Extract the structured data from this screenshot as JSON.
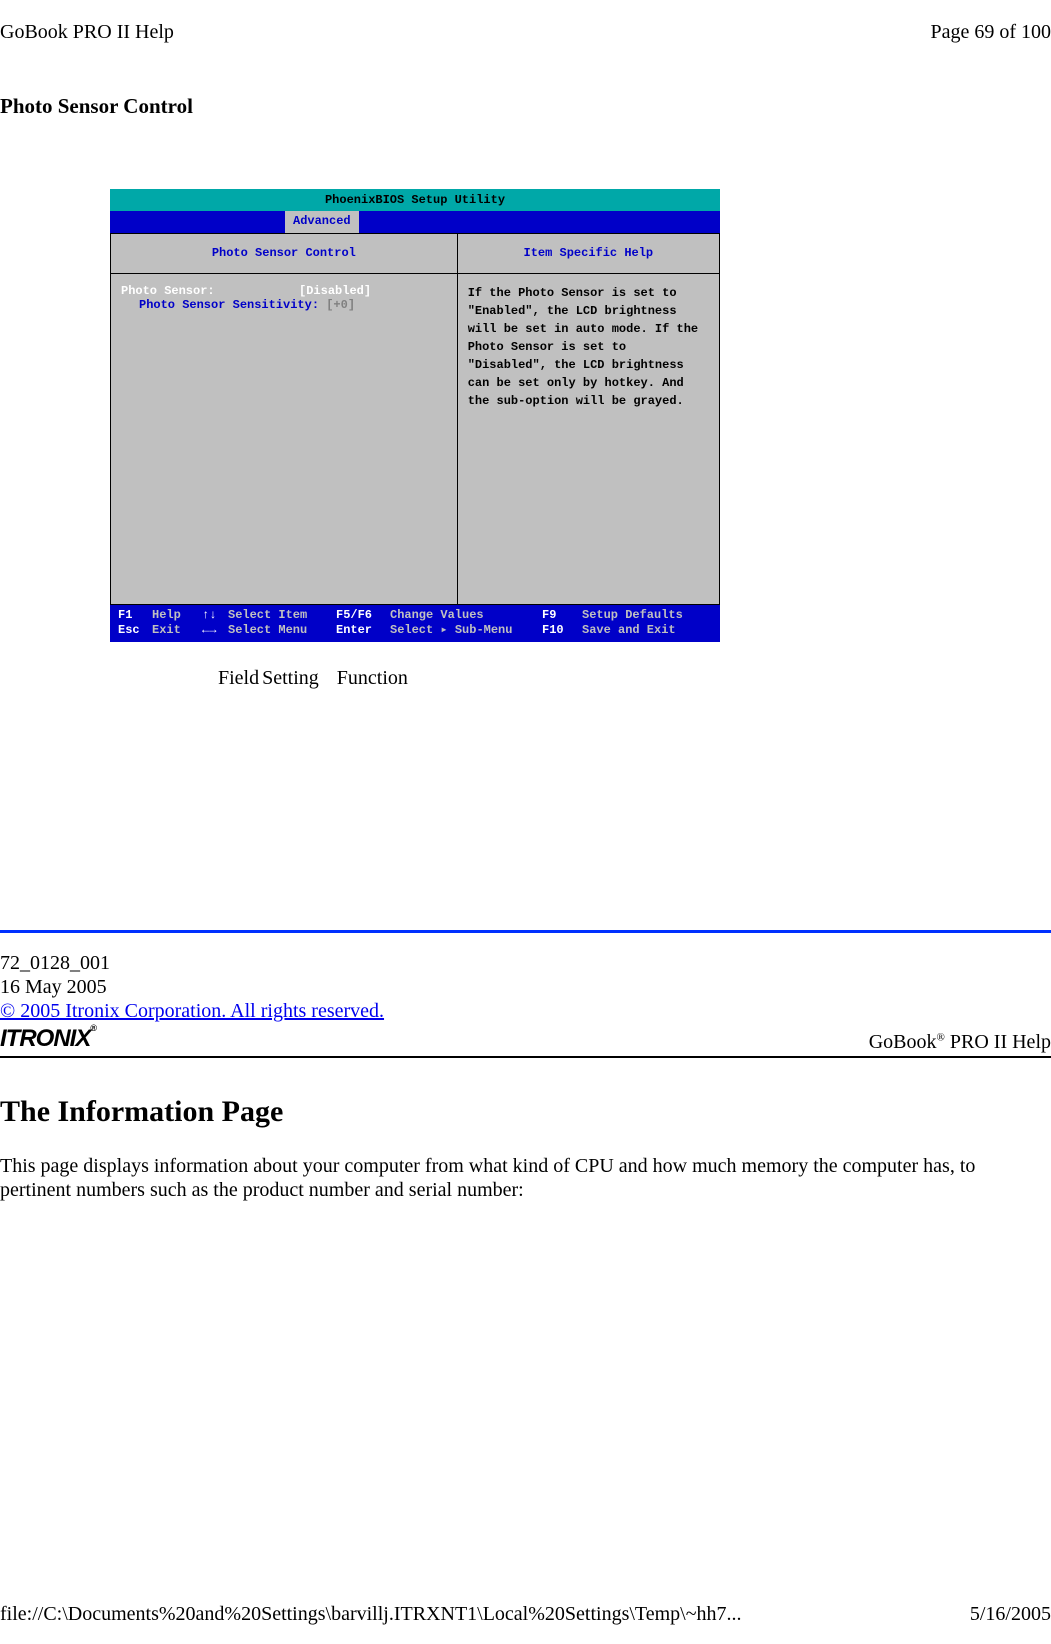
{
  "header": {
    "left": "GoBook PRO II Help",
    "right": "Page 69 of 100"
  },
  "section_title": "Photo Sensor Control",
  "bios": {
    "title": "PhoenixBIOS  Setup  Utility",
    "tab": "Advanced",
    "left_heading": "Photo  Sensor  Control",
    "right_heading": "Item  Specific  Help",
    "line1_label": "Photo Sensor:",
    "line1_value": "[Disabled]",
    "line2_label": "Photo Sensor Sensitivity:",
    "line2_value": "[+0]",
    "help_text": "If the Photo Sensor is set to \"Enabled\", the LCD brightness will be set in auto mode. If the Photo Sensor is set to \"Disabled\", the LCD brightness can be set only by hotkey. And the sub-option will be grayed.",
    "footer": {
      "row1": {
        "c1": "F1",
        "c2": "Help",
        "c3": "↑↓",
        "c4": "Select Item",
        "c5": "F5/F6",
        "c6": "Change Values",
        "c7": "F9",
        "c8": "Setup Defaults"
      },
      "row2": {
        "c1": "Esc",
        "c2": "Exit",
        "c3": "←→",
        "c4": "Select Menu",
        "c5": "Enter",
        "c6": "Select ▸ Sub-Menu",
        "c7": "F10",
        "c8": "Save and Exit"
      }
    }
  },
  "columns": {
    "field": "Field",
    "setting": "Setting",
    "function": "Function"
  },
  "footer_block": {
    "doc_num": " 72_0128_001",
    "date": "16 May 2005",
    "copyright": "© 2005 Itronix Corporation.  All rights reserved."
  },
  "logo_row": {
    "logo_text": "ITRONIX",
    "help_text_prefix": "GoBook",
    "help_text_suffix": " PRO II Help"
  },
  "info_page": {
    "title": "The Information Page",
    "body": "This page displays information about your computer from what kind of CPU and how much memory the computer has, to pertinent numbers such as the product number and serial number:"
  },
  "bottom_footer": {
    "left": "file://C:\\Documents%20and%20Settings\\barvillj.ITRXNT1\\Local%20Settings\\Temp\\~hh7...",
    "right": "5/16/2005"
  }
}
